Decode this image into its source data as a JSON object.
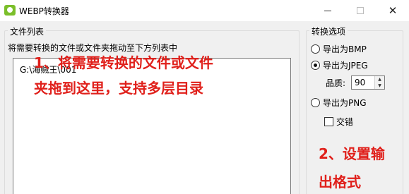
{
  "window": {
    "title": "WEBP转换器",
    "icon": "app-icon"
  },
  "file_panel": {
    "legend": "文件列表",
    "hint": "将需要转换的文件或文件夹拖动至下方列表中",
    "items": [
      "G:\\海贼王\\001"
    ],
    "annotation_line1": "1、将需要转换的文件或文件",
    "annotation_line2": "夹拖到这里，支持多层目录"
  },
  "options_panel": {
    "legend": "转换选项",
    "bmp_label": "导出为BMP",
    "jpeg_label": "导出为JPEG",
    "quality_label": "品质:",
    "quality_value": "90",
    "png_label": "导出为PNG",
    "interlace_label": "交错",
    "annotation_line1": "2、设置输",
    "annotation_line2": "出格式"
  },
  "state": {
    "selected_format": "JPEG",
    "interlace_checked": false
  },
  "colors": {
    "annotation": "#e0201b",
    "panel_bg": "#f0f0f0"
  }
}
